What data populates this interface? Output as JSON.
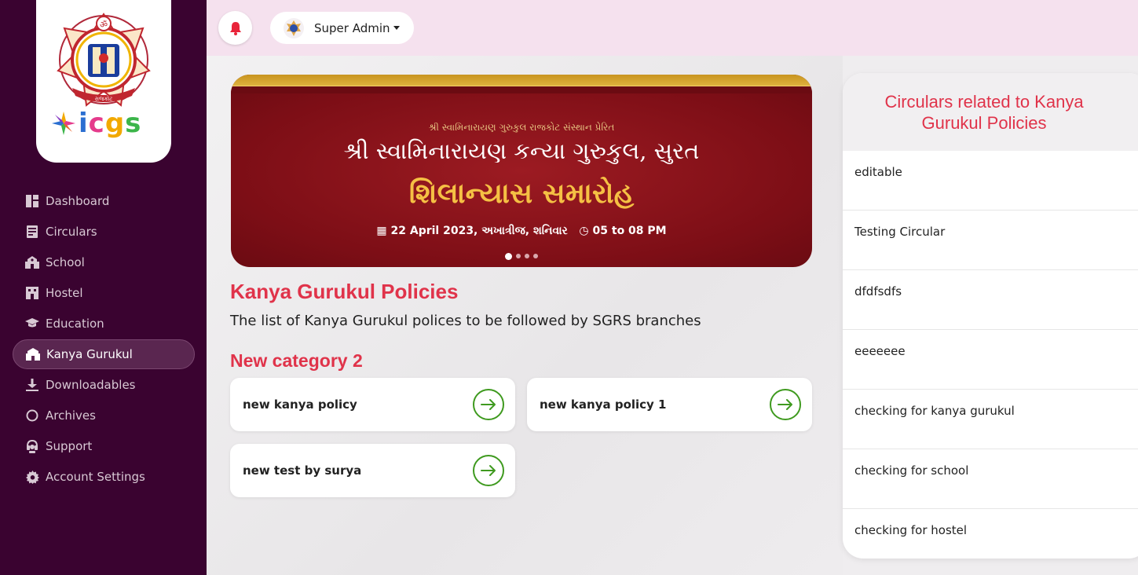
{
  "sidebar": {
    "logo_text": "icgs",
    "emblem_label": "રાજકોટ",
    "items": [
      {
        "label": "Dashboard",
        "icon": "dashboard-icon"
      },
      {
        "label": "Circulars",
        "icon": "circular-icon"
      },
      {
        "label": "School",
        "icon": "school-icon"
      },
      {
        "label": "Hostel",
        "icon": "hostel-icon"
      },
      {
        "label": "Education",
        "icon": "graduation-cap-icon"
      },
      {
        "label": "Kanya Gurukul",
        "icon": "building-icon",
        "active": true
      },
      {
        "label": "Downloadables",
        "icon": "download-icon"
      },
      {
        "label": "Archives",
        "icon": "archive-circle-icon"
      },
      {
        "label": "Support",
        "icon": "headset-icon"
      },
      {
        "label": "Account Settings",
        "icon": "gear-icon"
      }
    ]
  },
  "header": {
    "user_name": "Super Admin"
  },
  "banner": {
    "subtitle": "શ્રી સ્વામિનારાયણ ગુરુકુલ રાજકોટ સંસ્થાન પ્રેરિત",
    "title": "શ્રી સ્વામિનારાયણ કન્યા ગુરુકુલ, સુરત",
    "headline": "શિલાન્યાસ સમારોહ",
    "date": "22 April 2023, અખાત્રીજ, શનિવાર",
    "time": "05 to 08 PM",
    "slide_count": 4,
    "active_slide": 1
  },
  "main": {
    "title": "Kanya Gurukul Policies",
    "description": "The list of Kanya Gurukul polices to be followed by SGRS branches",
    "category": "New category 2",
    "policies": [
      "new kanya policy",
      "new kanya policy 1",
      "new test by surya"
    ]
  },
  "circulars": {
    "title": "Circulars related to Kanya Gurukul Policies",
    "items": [
      "editable",
      "Testing Circular",
      "dfdfsdfs",
      "eeeeeee",
      "checking for kanya gurukul",
      "checking for school",
      "checking for hostel"
    ]
  },
  "colors": {
    "sidebar_bg": "#3a0330",
    "accent": "#e0334a",
    "header_bg": "#f5e1ee",
    "arrow_green": "#3f9a1f"
  }
}
